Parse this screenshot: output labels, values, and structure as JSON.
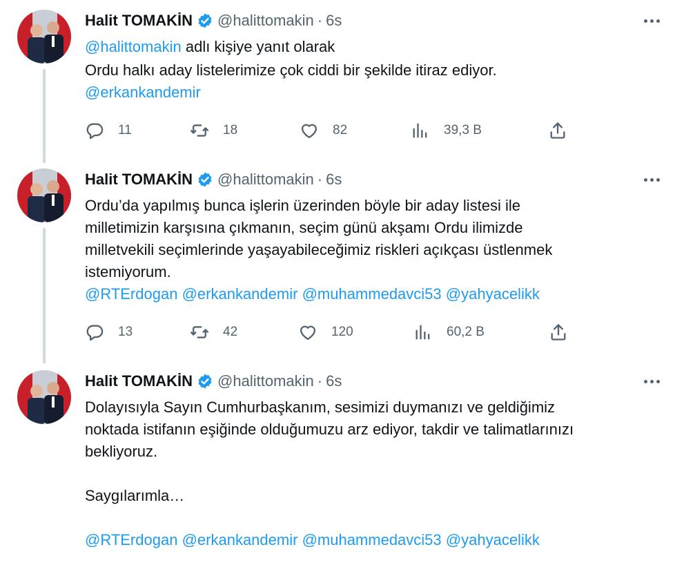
{
  "author": {
    "name": "Halit TOMAKİN",
    "handle": "@halittomakin",
    "separator": "·"
  },
  "tweets": [
    {
      "time": "6s",
      "reply_to_handle": "@halittomakin",
      "reply_to_suffix": " adlı kişiye yanıt olarak",
      "text_lines": [
        "Ordu halkı aday listelerimize çok ciddi bir şekilde itiraz ediyor."
      ],
      "mentions": [
        "@erkankandemir"
      ],
      "stats": {
        "replies": "11",
        "retweets": "18",
        "likes": "82",
        "views": "39,3 B"
      }
    },
    {
      "time": "6s",
      "text_lines": [
        "Ordu’da yapılmış bunca işlerin üzerinden böyle bir aday listesi ile",
        "milletimizin karşısına çıkmanın, seçim günü akşamı Ordu ilimizde",
        "milletvekili seçimlerinde yaşayabileceğimiz riskleri açıkçası üstlenmek",
        "istemiyorum."
      ],
      "mentions": [
        "@RTErdogan",
        "@erkankandemir",
        "@muhammedavci53",
        "@yahyacelikk"
      ],
      "stats": {
        "replies": "13",
        "retweets": "42",
        "likes": "120",
        "views": "60,2 B"
      }
    },
    {
      "time": "6s",
      "text_lines": [
        "Dolayısıyla Sayın Cumhurbaşkanım, sesimizi duymanızı ve geldiğimiz",
        "noktada istifanın eşiğinde olduğumuzu arz ediyor, takdir ve talimatlarınızı",
        "bekliyoruz."
      ],
      "closing": "Saygılarımla…",
      "mentions": [
        "@RTErdogan",
        "@erkankandemir",
        "@muhammedavci53",
        "@yahyacelikk"
      ]
    }
  ],
  "icons": {
    "verified": "verified-badge-icon",
    "more": "more-options-icon",
    "reply": "reply-icon",
    "retweet": "retweet-icon",
    "like": "heart-icon",
    "views": "views-icon",
    "share": "share-icon"
  },
  "colors": {
    "text": "#0f1419",
    "secondary": "#536471",
    "link": "#1d9bf0",
    "thread_line": "#cfd9de"
  }
}
